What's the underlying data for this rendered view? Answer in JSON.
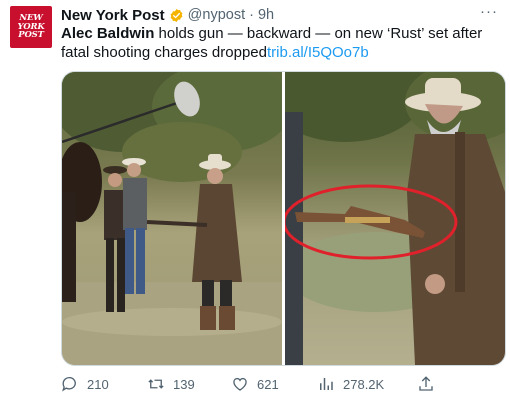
{
  "account": {
    "logo_lines": [
      "NEW",
      "YORK",
      "POST"
    ],
    "name": "New York Post",
    "handle": "@nypost",
    "separator": "·",
    "time": "9h",
    "more_label": "···"
  },
  "tweet": {
    "bold_text": "Alec Baldwin",
    "text": " holds gun — backward — on new ‘Rust’ set after fatal shooting charges dropped",
    "link": "trib.al/I5QOo7b"
  },
  "actions": {
    "replies": "210",
    "retweets": "139",
    "likes": "621",
    "views": "278.2K"
  },
  "colors": {
    "brand": "#c8102e",
    "link": "#1d9bf0",
    "verified": "#f4b400",
    "muted": "#536471",
    "annotation_circle": "#e0202a"
  }
}
